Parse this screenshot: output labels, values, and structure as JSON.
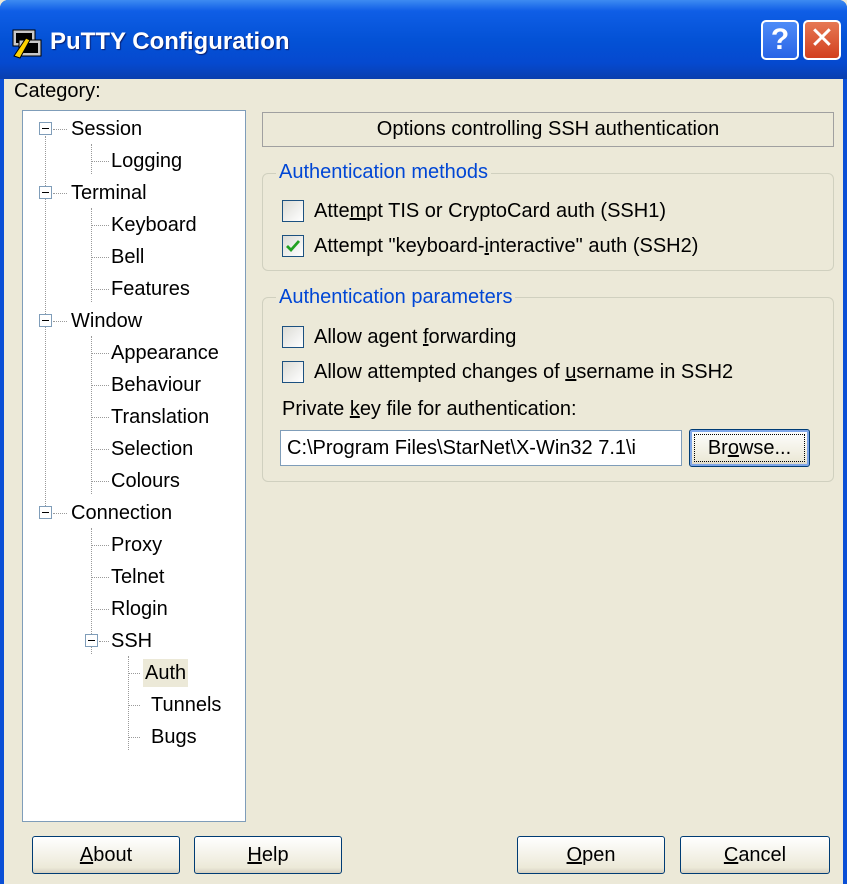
{
  "window": {
    "title": "PuTTY Configuration",
    "help_glyph": "?",
    "close_glyph": "✕",
    "accent_color": "#0452d6"
  },
  "category_label": "Category:",
  "tree": [
    {
      "label": "Session",
      "expander": true
    },
    {
      "label": "Logging"
    },
    {
      "label": "Terminal",
      "expander": true
    },
    {
      "label": "Keyboard"
    },
    {
      "label": "Bell"
    },
    {
      "label": "Features"
    },
    {
      "label": "Window",
      "expander": true
    },
    {
      "label": "Appearance"
    },
    {
      "label": "Behaviour"
    },
    {
      "label": "Translation"
    },
    {
      "label": "Selection"
    },
    {
      "label": "Colours"
    },
    {
      "label": "Connection",
      "expander": true
    },
    {
      "label": "Proxy"
    },
    {
      "label": "Telnet"
    },
    {
      "label": "Rlogin"
    },
    {
      "label": "SSH",
      "expander": true
    },
    {
      "label": "Auth",
      "selected": true
    },
    {
      "label": "Tunnels"
    },
    {
      "label": "Bugs"
    }
  ],
  "panel": {
    "header": "Options controlling SSH authentication",
    "auth_methods": {
      "title": "Authentication methods",
      "tis": {
        "pre": "Atte",
        "mnemonic": "m",
        "post": "pt TIS or CryptoCard auth (SSH1)",
        "checked": false
      },
      "ki": {
        "pre": "Attempt \"keyboard-",
        "mnemonic": "i",
        "post": "nteractive\" auth (SSH2)",
        "checked": true
      }
    },
    "auth_params": {
      "title": "Authentication parameters",
      "agent_fwd": {
        "pre": "Allow agent ",
        "mnemonic": "f",
        "post": "orwarding",
        "checked": false
      },
      "username_change": {
        "pre": "Allow attempted changes of ",
        "mnemonic": "u",
        "post": "sername in SSH2",
        "checked": false
      },
      "keyfile_label": {
        "pre": "Private ",
        "mnemonic": "k",
        "post": "ey file for authentication:"
      },
      "keyfile_value": "C:\\Program Files\\StarNet\\X-Win32 7.1\\i",
      "browse": {
        "pre": "Br",
        "mnemonic": "o",
        "post": "wse..."
      }
    }
  },
  "buttons": {
    "about": {
      "mnemonic": "A",
      "post": "bout"
    },
    "help": {
      "mnemonic": "H",
      "post": "elp"
    },
    "open": {
      "mnemonic": "O",
      "post": "pen"
    },
    "cancel": {
      "mnemonic": "C",
      "post": "ancel"
    }
  }
}
